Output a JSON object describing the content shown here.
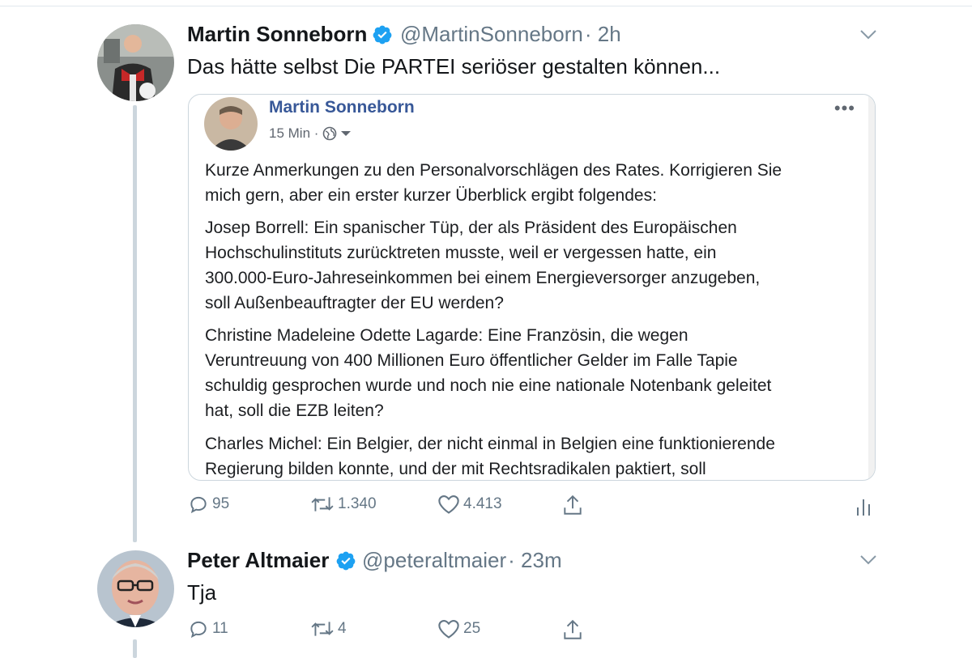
{
  "tweet1": {
    "name": "Martin Sonneborn",
    "handle": "@MartinSonneborn",
    "time": "· 2h",
    "text": "Das hätte selbst Die PARTEI seriöser gestalten können...",
    "embedded": {
      "name": "Martin Sonneborn",
      "meta": "15 Min ·",
      "paragraphs": [
        [
          "Kurze Anmerkungen zu den Personalvorschlägen des Rates. Korrigieren Sie",
          "mich gern, aber ein erster kurzer Überblick ergibt folgendes:"
        ],
        [
          "Josep Borrell: Ein spanischer Tüp, der als Präsident des Europäischen",
          "Hochschulinstituts zurücktreten musste, weil er vergessen hatte, ein",
          "300.000-Euro-Jahreseinkommen bei einem Energieversorger anzugeben,",
          "soll Außenbeauftragter der EU werden?"
        ],
        [
          "Christine Madeleine Odette Lagarde: Eine Französin, die wegen",
          "Veruntreuung von 400 Millionen Euro öffentlicher Gelder im Falle Tapie",
          "schuldig gesprochen wurde und noch nie eine nationale Notenbank geleitet",
          "hat, soll die EZB leiten?"
        ],
        [
          "Charles Michel: Ein Belgier, der nicht einmal in Belgien eine funktionierende",
          "Regierung bilden konnte, und der mit Rechtsradikalen paktiert, soll"
        ]
      ]
    },
    "actions": {
      "replies": "95",
      "retweets": "1.340",
      "likes": "4.413"
    }
  },
  "tweet2": {
    "name": "Peter Altmaier",
    "handle": "@peteraltmaier",
    "time": "· 23m",
    "text": "Tja",
    "actions": {
      "replies": "11",
      "retweets": "4",
      "likes": "25"
    }
  },
  "colors": {
    "accent": "#1da1f2",
    "secondary": "#657786",
    "fb_name": "#385898"
  },
  "icons": [
    "verified-badge-icon",
    "chevron-down-icon",
    "reply-icon",
    "retweet-icon",
    "like-icon",
    "share-icon",
    "analytics-icon",
    "globe-icon",
    "more-dots-icon"
  ]
}
